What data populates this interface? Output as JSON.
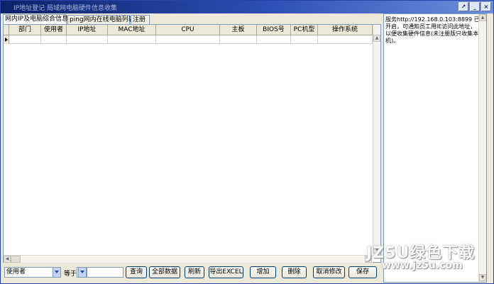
{
  "window": {
    "title": "IP地址登记 局域网电脑硬件信息收集",
    "controls": [
      "restore-icon",
      "minimize-icon",
      "close-icon"
    ]
  },
  "tabs": [
    {
      "label": "网内IP及电脑综合信息",
      "active": true
    },
    {
      "label": "ping网内在线电脑列表",
      "active": false
    },
    {
      "label": "注册",
      "active": false
    }
  ],
  "grid": {
    "columns": [
      "部门",
      "使用者",
      "IP地址",
      "MAC地址",
      "CPU",
      "主板",
      "BIOS号",
      "PC机型",
      "操作系统"
    ],
    "rows": [
      [
        "",
        "",
        "",
        "",
        "",
        "",
        "",
        "",
        ""
      ]
    ]
  },
  "toolbar": {
    "field_select": "使用者",
    "operator_label": "等于",
    "operator_select": "",
    "query_value": "",
    "buttons": [
      "查询",
      "全部数据",
      "刷新",
      "导出EXCEL",
      "增加",
      "删除",
      "取消修改",
      "保存"
    ]
  },
  "side_panel": {
    "text": "服务http://192.168.0.103:8899 已开启，可通知员工用IE访问此地址，以便收集硬件信息(未注册版只收集本机)。"
  },
  "watermark": {
    "line1": "JZ5U绿色下载",
    "line2": "www.jz5u.com"
  }
}
